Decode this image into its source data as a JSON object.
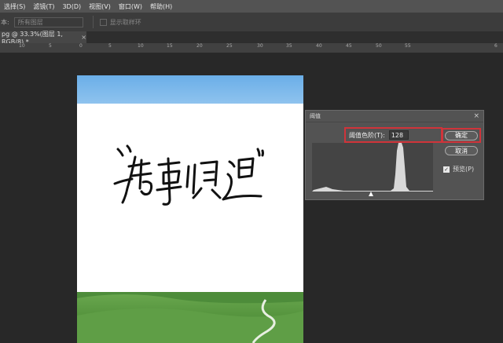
{
  "menubar": {
    "items": [
      "选择(S)",
      "滤镜(T)",
      "3D(D)",
      "视图(V)",
      "窗口(W)",
      "帮助(H)"
    ]
  },
  "options": {
    "label": "本:",
    "sample_select": "所有图层",
    "show_ring_label": "显示取样环"
  },
  "document_tab": {
    "title": "pg @ 33.3%(图层 1, RGB/8) *",
    "close": "×"
  },
  "ruler": {
    "ticks": [
      "10",
      "5",
      "0",
      "5",
      "10",
      "15",
      "20",
      "25",
      "30",
      "35",
      "40",
      "45",
      "50",
      "55",
      "6"
    ]
  },
  "threshold_dialog": {
    "title": "阈值",
    "close": "×",
    "level_label": "阈值色阶(T):",
    "level_value": "128",
    "ok_label": "确定",
    "cancel_label": "取消",
    "preview_label": "预览(P)",
    "preview_checked": true
  },
  "colors": {
    "highlight": "#d0343a",
    "panel": "#535353",
    "canvas_bg": "#282828"
  }
}
